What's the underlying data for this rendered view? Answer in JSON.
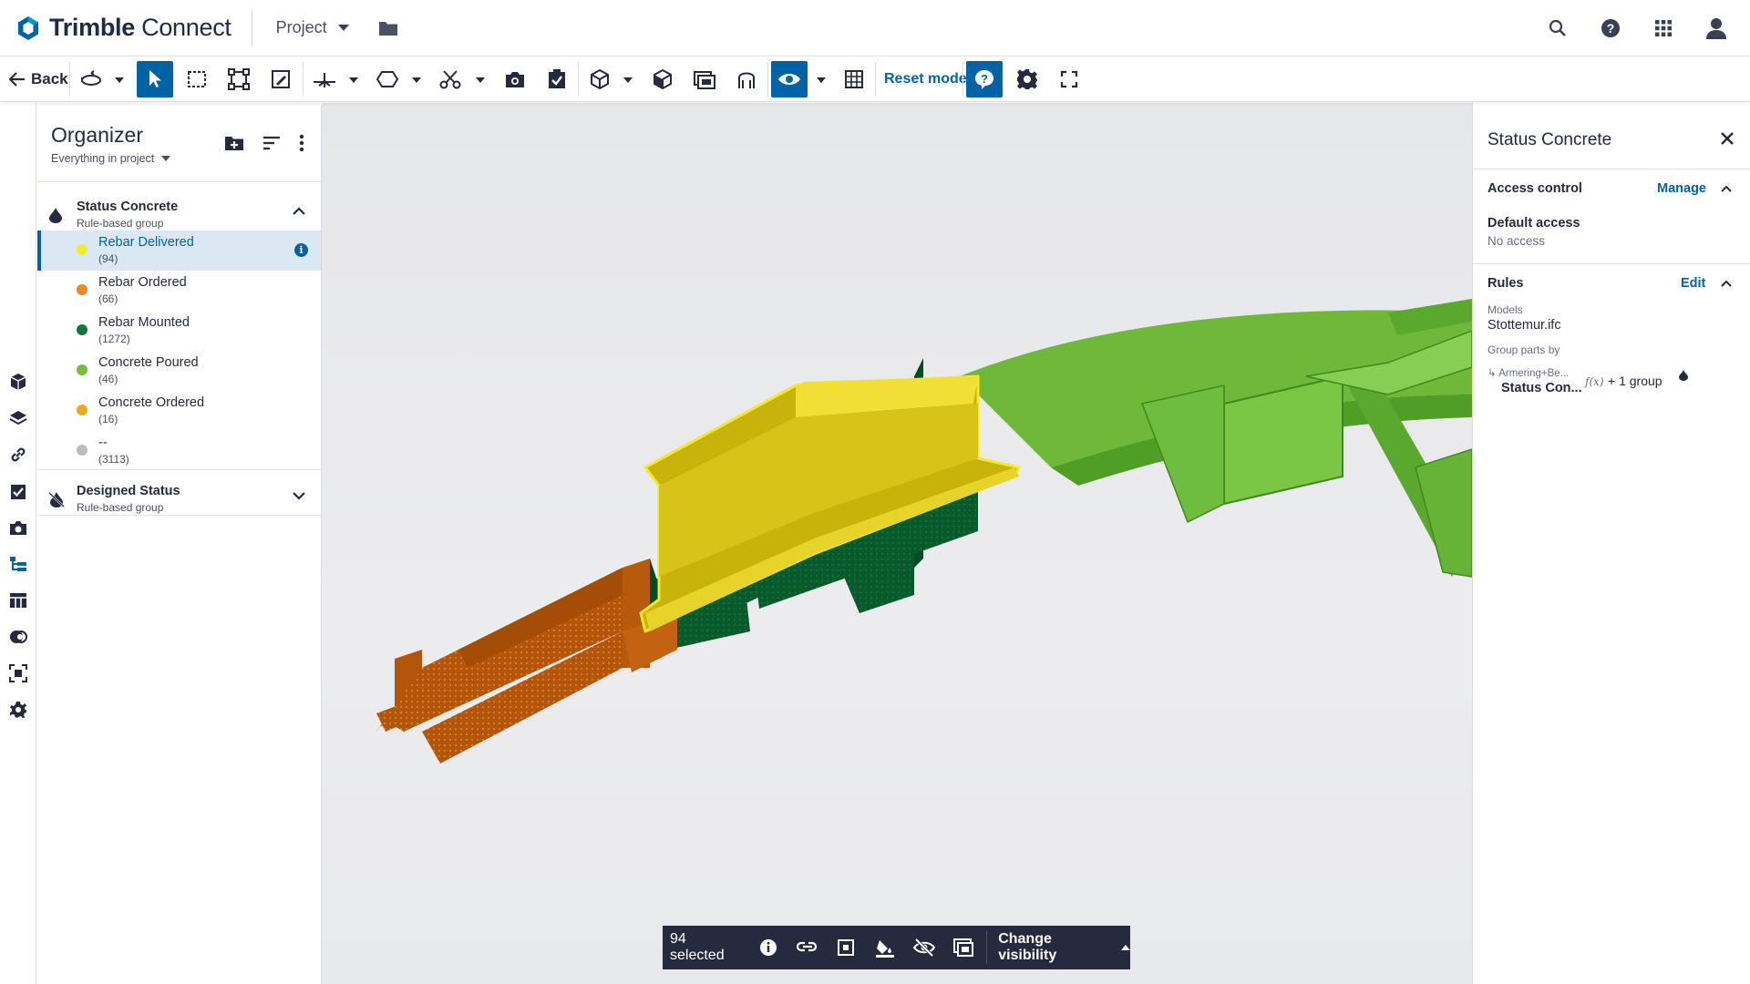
{
  "brand": {
    "name_bold": "Trimble",
    "name_rest": " Connect"
  },
  "topbar": {
    "project_label": "Project"
  },
  "toolbar": {
    "back_label": "Back",
    "reset_label": "Reset model"
  },
  "organizer": {
    "title": "Organizer",
    "scope": "Everything in project",
    "groups": [
      {
        "title": "Status Concrete",
        "subtitle": "Rule-based group",
        "expanded": true,
        "items": [
          {
            "label": "Rebar Delivered",
            "count": "(94)",
            "color": "#f0ec2c",
            "selected": true
          },
          {
            "label": "Rebar Ordered",
            "count": "(66)",
            "color": "#e88a1f"
          },
          {
            "label": "Rebar Mounted",
            "count": "(1272)",
            "color": "#0e7a3a"
          },
          {
            "label": "Concrete Poured",
            "count": "(46)",
            "color": "#6fc03a"
          },
          {
            "label": "Concrete Ordered",
            "count": "(16)",
            "color": "#f0a91c"
          },
          {
            "label": "--",
            "count": "(3113)",
            "color": "#bcbcbc"
          }
        ]
      },
      {
        "title": "Designed Status",
        "subtitle": "Rule-based group",
        "expanded": false
      }
    ]
  },
  "details": {
    "title": "Status Concrete",
    "access_control": "Access control",
    "manage": "Manage",
    "default_access_label": "Default access",
    "default_access_value": "No access",
    "rules": "Rules",
    "edit": "Edit",
    "models_label": "Models",
    "models_value": "Stottemur.ifc",
    "group_by_label": "Group parts by",
    "group_path": "Armering+Be...",
    "group_prop": "Status Con...",
    "fx": "f(x)",
    "group_more": "+ 1 group"
  },
  "selection": {
    "count": "94 selected",
    "change_visibility": "Change visibility"
  },
  "colors": {
    "accent": "#0063a3",
    "dark_bar": "#252a3f",
    "rebar_delivered": "#f0ec2c",
    "rebar_ordered": "#e88a1f",
    "rebar_mounted": "#0e7a3a",
    "concrete_poured": "#6fc03a"
  }
}
